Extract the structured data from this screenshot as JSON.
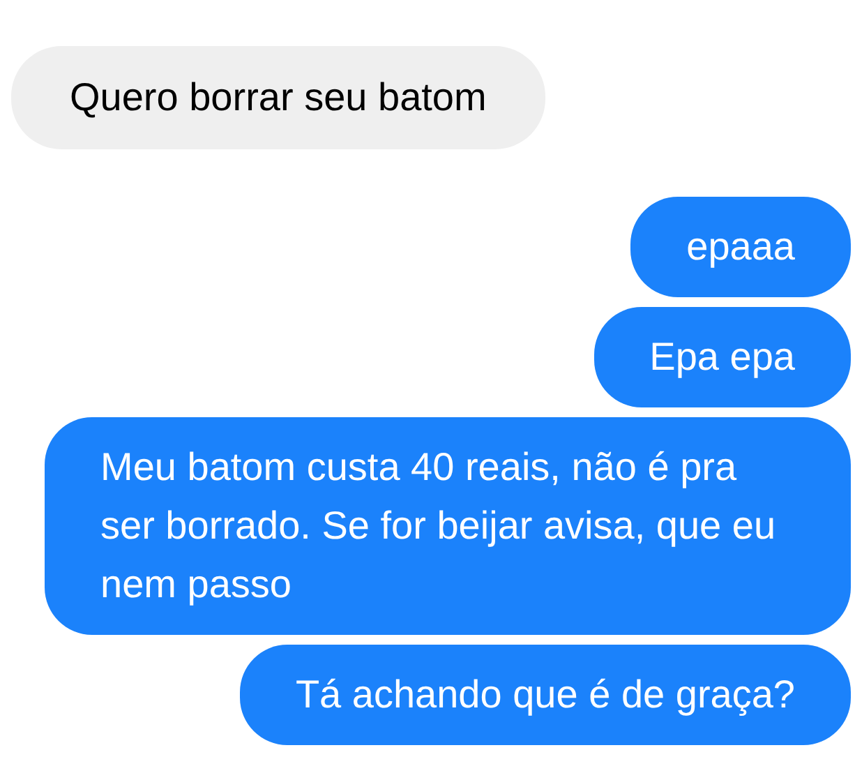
{
  "messages": [
    {
      "kind": "received",
      "text": "Quero borrar seu batom"
    },
    {
      "kind": "sent",
      "text": "epaaa"
    },
    {
      "kind": "sent",
      "text": "Epa epa"
    },
    {
      "kind": "sent",
      "text": "Meu batom custa 40 reais, não é pra ser borrado. Se for beijar avisa, que eu nem passo"
    },
    {
      "kind": "sent",
      "text": "Tá achando que é de graça?"
    }
  ]
}
